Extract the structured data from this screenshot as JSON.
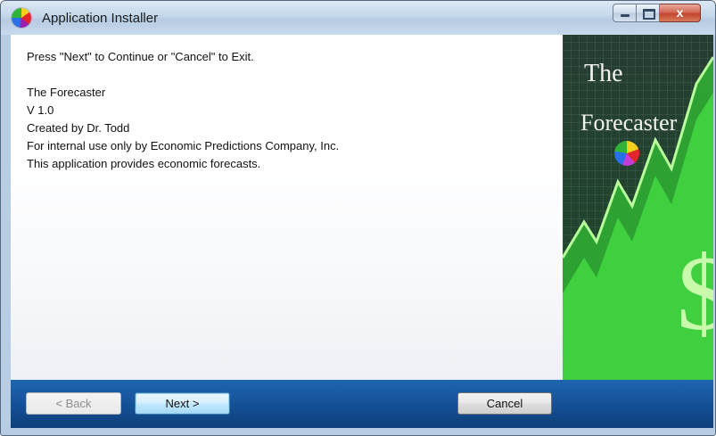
{
  "window": {
    "title": "Application Installer",
    "icon": "color-wheel-icon"
  },
  "caption_buttons": {
    "minimize": "minimize-icon",
    "maximize": "maximize-icon",
    "close_glyph": "x"
  },
  "content": {
    "instruction": "Press \"Next\" to Continue or \"Cancel\" to Exit.",
    "product_name": "The Forecaster",
    "version": "V 1.0",
    "author": "Created by Dr. Todd",
    "license": "For internal use only by Economic Predictions Company, Inc.",
    "description": "This application provides economic forecasts."
  },
  "side_image": {
    "brand_line1": "The",
    "brand_line2": "Forecaster"
  },
  "footer": {
    "back_label": "< Back",
    "back_enabled": false,
    "next_label": "Next >",
    "cancel_label": "Cancel"
  },
  "colors": {
    "footer_blue": "#144f95",
    "default_button": "#bee6fd",
    "chart_green": "#35c53a"
  }
}
